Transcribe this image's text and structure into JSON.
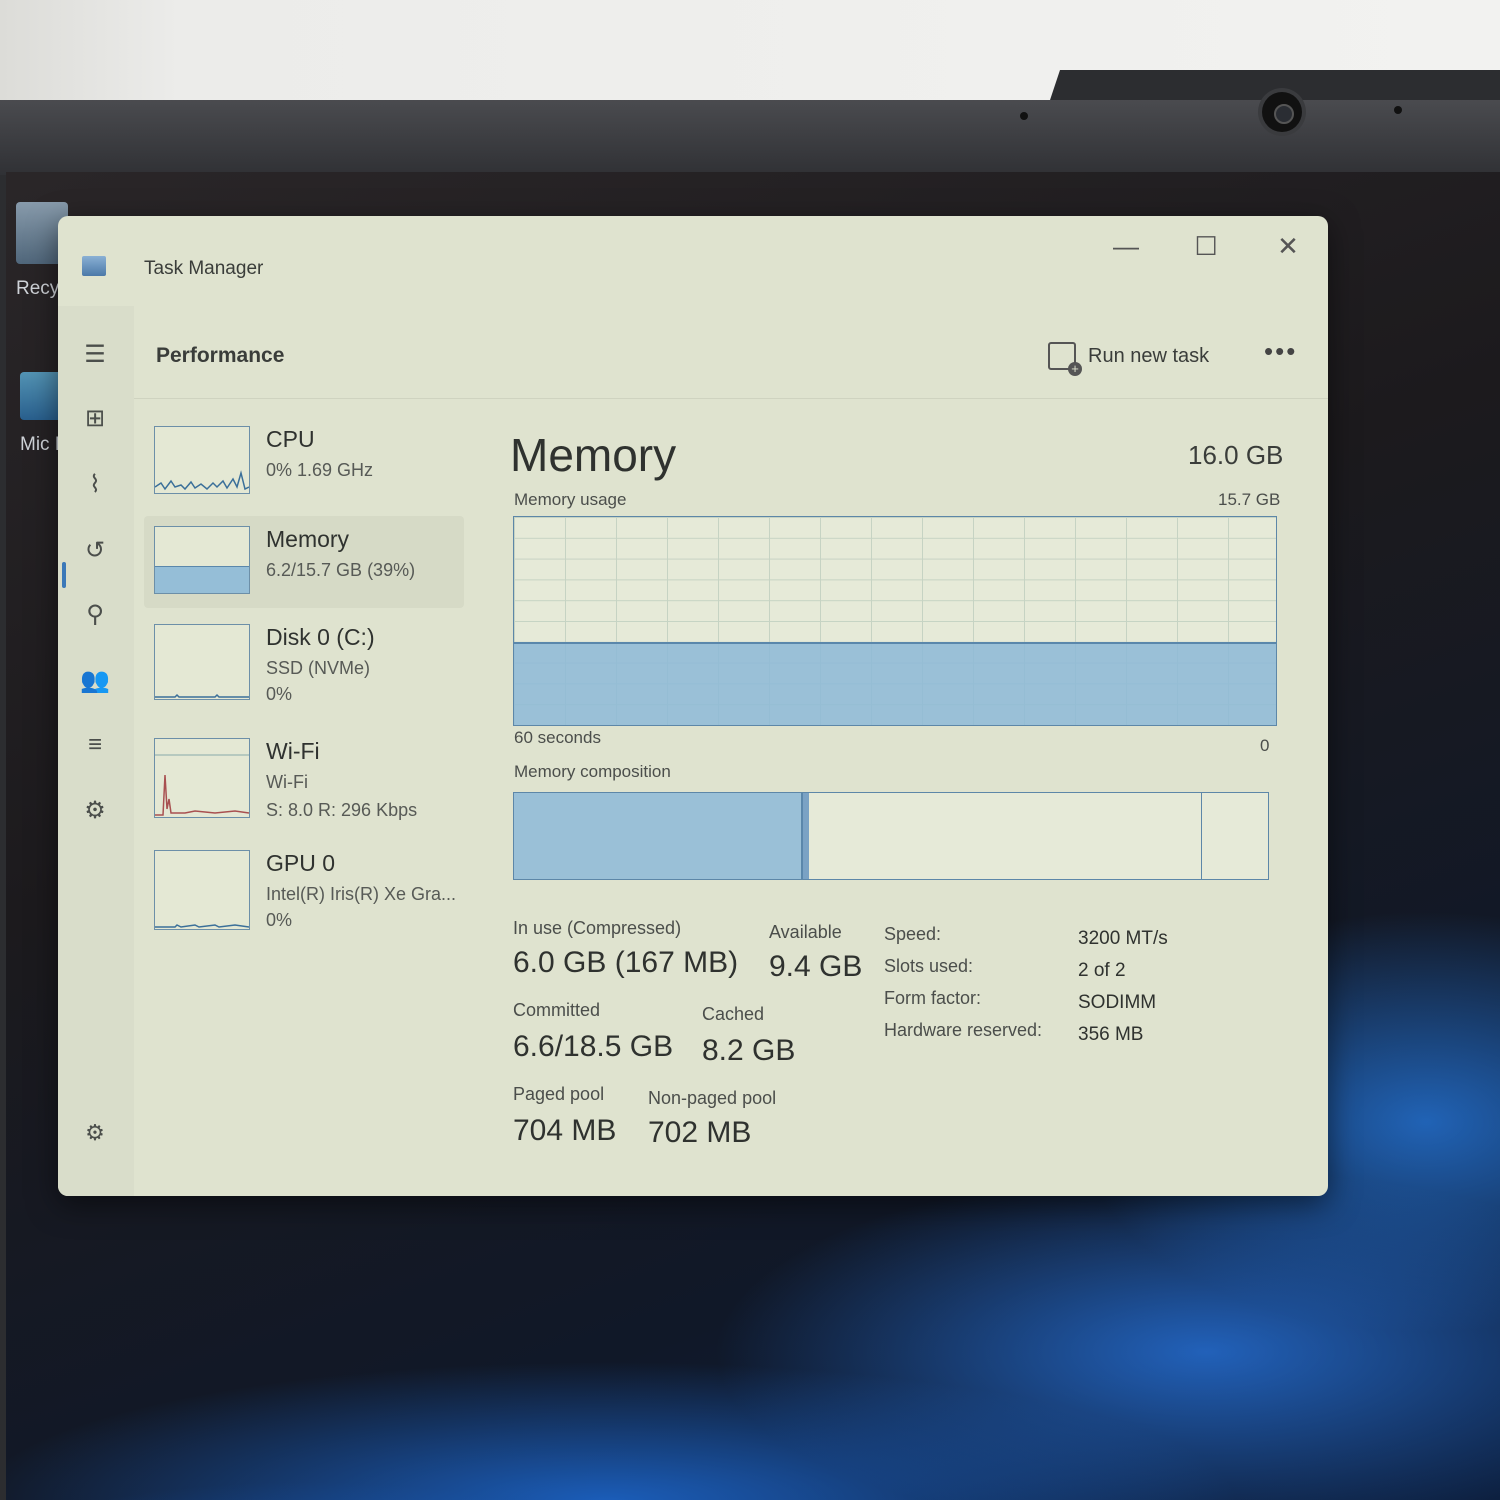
{
  "desktop": {
    "icons": [
      {
        "label": "Recy",
        "icon": "recycle-bin-icon"
      },
      {
        "label": "Mic E",
        "icon": "edge-shortcut-icon"
      }
    ]
  },
  "window": {
    "title": "Task Manager",
    "controls": {
      "minimize": "—",
      "maximize": "☐",
      "close": "✕"
    }
  },
  "nav": {
    "items": [
      {
        "name": "menu",
        "glyph": "☰"
      },
      {
        "name": "processes",
        "glyph": "⊞"
      },
      {
        "name": "performance",
        "glyph": "⌇"
      },
      {
        "name": "app-history",
        "glyph": "↺"
      },
      {
        "name": "startup-apps",
        "glyph": "⚲"
      },
      {
        "name": "users",
        "glyph": "👥"
      },
      {
        "name": "details",
        "glyph": "≡"
      },
      {
        "name": "services",
        "glyph": "⚙"
      }
    ],
    "settings_glyph": "⚙"
  },
  "header": {
    "page_title": "Performance",
    "run_new_task": "Run new task",
    "more": "•••"
  },
  "resources": [
    {
      "name": "CPU",
      "line1": "0% 1.69 GHz",
      "line2": ""
    },
    {
      "name": "Memory",
      "line1": "6.2/15.7 GB (39%)",
      "line2": ""
    },
    {
      "name": "Disk 0 (C:)",
      "line1": "SSD (NVMe)",
      "line2": "0%"
    },
    {
      "name": "Wi-Fi",
      "line1": "Wi-Fi",
      "line2": "S: 8.0 R: 296 Kbps"
    },
    {
      "name": "GPU 0",
      "line1": "Intel(R) Iris(R) Xe Gra...",
      "line2": "0%"
    }
  ],
  "memory": {
    "title": "Memory",
    "total": "16.0 GB",
    "usage_label": "Memory usage",
    "usage_max": "15.7 GB",
    "usage_fraction": 0.39,
    "axis_left": "60 seconds",
    "axis_right": "0",
    "composition_label": "Memory composition",
    "composition": {
      "in_use": 0.38,
      "standby": 0.52
    },
    "stats": {
      "in_use_label": "In use (Compressed)",
      "in_use_value": "6.0 GB (167 MB)",
      "available_label": "Available",
      "available_value": "9.4 GB",
      "committed_label": "Committed",
      "committed_value": "6.6/18.5 GB",
      "cached_label": "Cached",
      "cached_value": "8.2 GB",
      "paged_label": "Paged pool",
      "paged_value": "704 MB",
      "nonpaged_label": "Non-paged pool",
      "nonpaged_value": "702 MB"
    },
    "details": [
      {
        "key": "Speed:",
        "value": "3200 MT/s"
      },
      {
        "key": "Slots used:",
        "value": "2 of 2"
      },
      {
        "key": "Form factor:",
        "value": "SODIMM"
      },
      {
        "key": "Hardware reserved:",
        "value": "356 MB"
      }
    ]
  }
}
